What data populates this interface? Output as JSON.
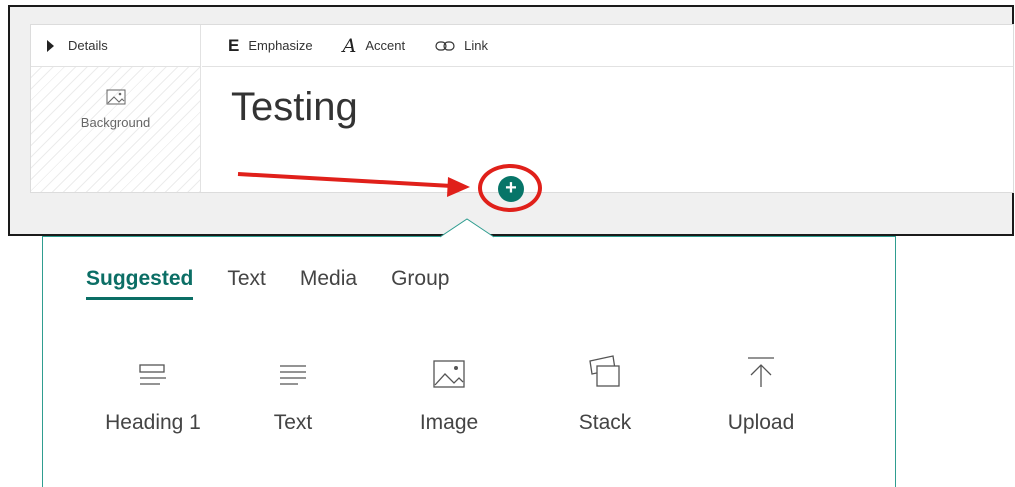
{
  "editor": {
    "details_label": "Details",
    "background_label": "Background",
    "toolbar": {
      "emphasize_icon": "E",
      "emphasize_label": "Emphasize",
      "accent_icon": "A",
      "accent_label": "Accent",
      "link_label": "Link"
    },
    "title": "Testing",
    "add_button_symbol": "+"
  },
  "insert_panel": {
    "tabs": [
      {
        "label": "Suggested",
        "active": true
      },
      {
        "label": "Text"
      },
      {
        "label": "Media"
      },
      {
        "label": "Group"
      }
    ],
    "items": [
      {
        "label": "Heading 1",
        "icon": "heading-icon"
      },
      {
        "label": "Text",
        "icon": "text-icon"
      },
      {
        "label": "Image",
        "icon": "image-icon"
      },
      {
        "label": "Stack",
        "icon": "stack-icon"
      },
      {
        "label": "Upload",
        "icon": "upload-icon"
      }
    ]
  },
  "colors": {
    "accent": "#077568",
    "highlight": "#e0201a",
    "panel_border": "#2f9d90"
  }
}
